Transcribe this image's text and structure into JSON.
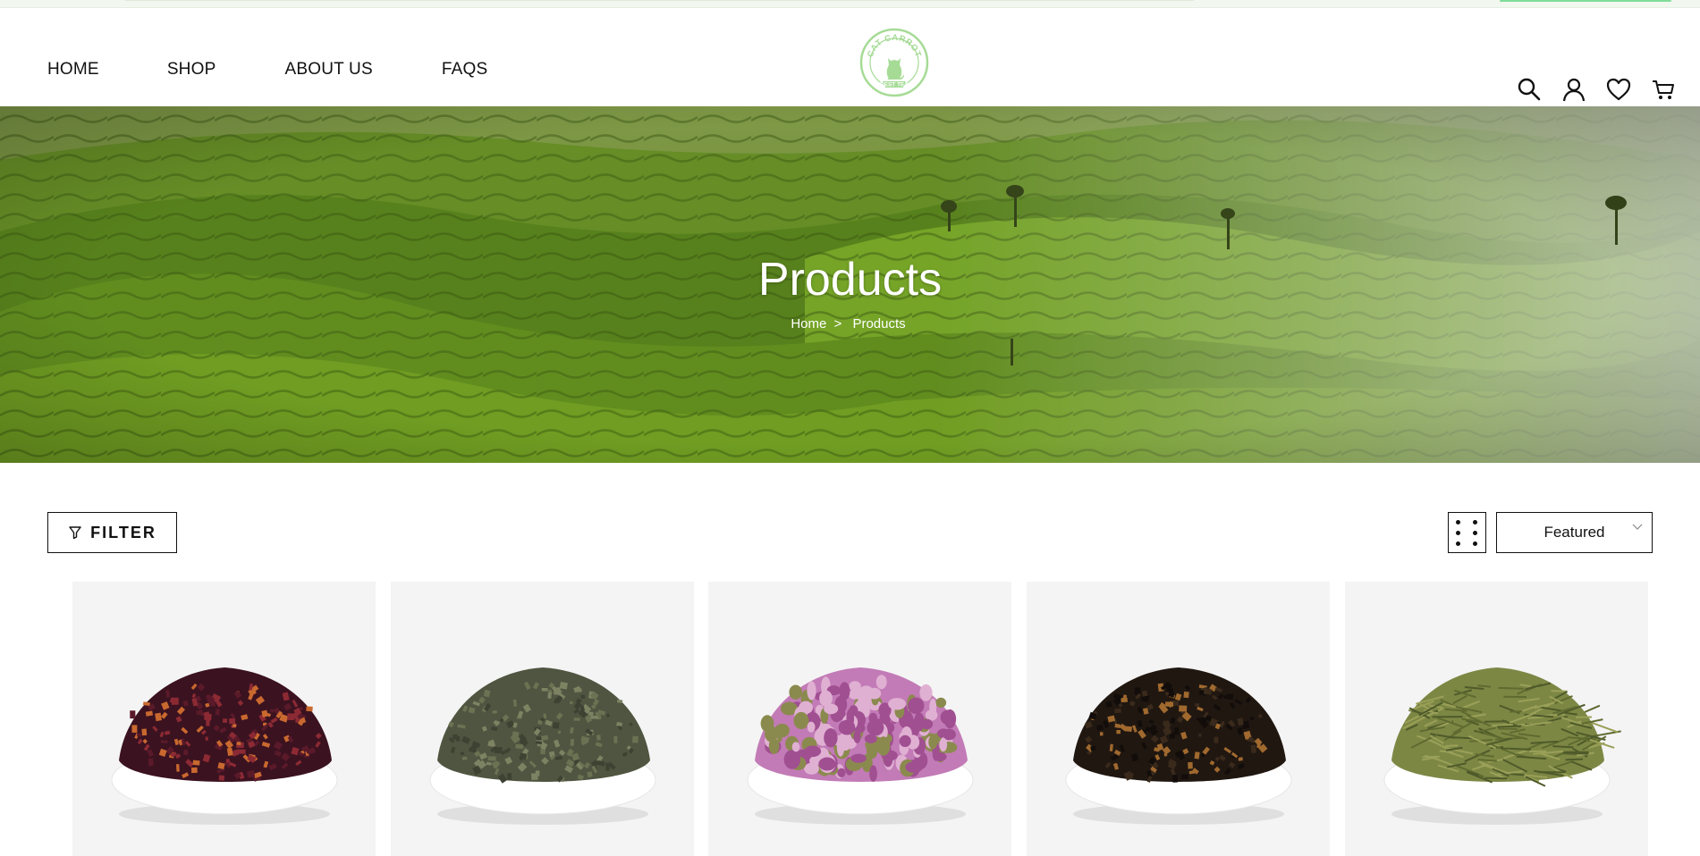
{
  "nav": {
    "items": [
      {
        "label": "HOME"
      },
      {
        "label": "SHOP"
      },
      {
        "label": "ABOUT US"
      },
      {
        "label": "FAQS"
      }
    ]
  },
  "logo": {
    "name": "cat-carrot-logo",
    "text_top": "CAT CARROT",
    "text_bottom": "BEST TEA",
    "color": "#a6db96"
  },
  "header_icons": [
    "search-icon",
    "account-icon",
    "wishlist-heart-icon",
    "cart-icon"
  ],
  "hero": {
    "title": "Products",
    "breadcrumb": {
      "home": "Home",
      "separator": ">",
      "current": "Products"
    }
  },
  "toolbar": {
    "filter_label": "FILTER",
    "sort_value": "Featured"
  },
  "products": [
    {
      "name": "fruit-hibiscus-tea",
      "colors": [
        "#3b1220",
        "#8c2a34",
        "#c9692f",
        "#5a1a2a"
      ]
    },
    {
      "name": "gunpowder-green-tea",
      "colors": [
        "#4f5540",
        "#6b7253",
        "#3d4232",
        "#7d8263"
      ]
    },
    {
      "name": "rose-bud-tea",
      "colors": [
        "#c27bb6",
        "#a04f91",
        "#e0b0d3",
        "#8b8a4e"
      ]
    },
    {
      "name": "black-tea",
      "colors": [
        "#201711",
        "#3a2a1c",
        "#a0692e",
        "#120d0a"
      ]
    },
    {
      "name": "needle-green-tea",
      "colors": [
        "#7d8744",
        "#5f6a30",
        "#9aa058",
        "#4e5a2a"
      ]
    }
  ],
  "colors": {
    "accent": "#a6db96",
    "border": "#111111",
    "card_bg": "#f4f4f4"
  }
}
